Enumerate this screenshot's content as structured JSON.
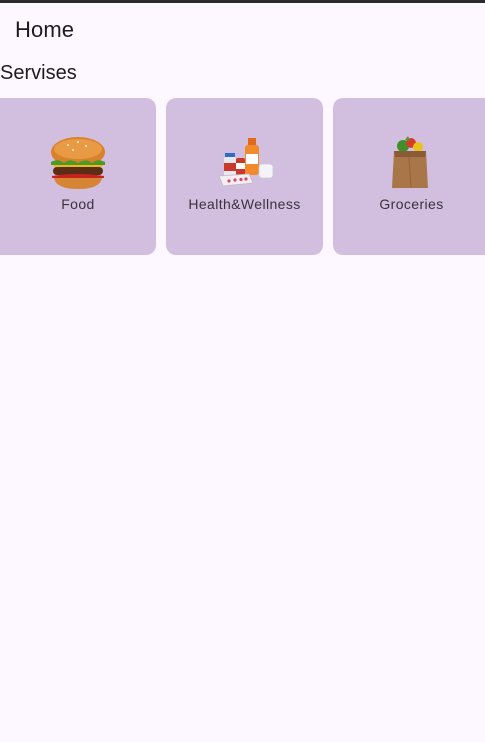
{
  "app_bar": {
    "title": "Home"
  },
  "services": {
    "heading": "Servises",
    "items": [
      {
        "label": "Food",
        "icon": "burger-icon"
      },
      {
        "label": "Health&Wellness",
        "icon": "medicine-icon"
      },
      {
        "label": "Groceries",
        "icon": "grocery-bag-icon"
      }
    ]
  },
  "colors": {
    "background": "#fdf7ff",
    "card": "#d2bedf",
    "text": "#1d1b20"
  }
}
